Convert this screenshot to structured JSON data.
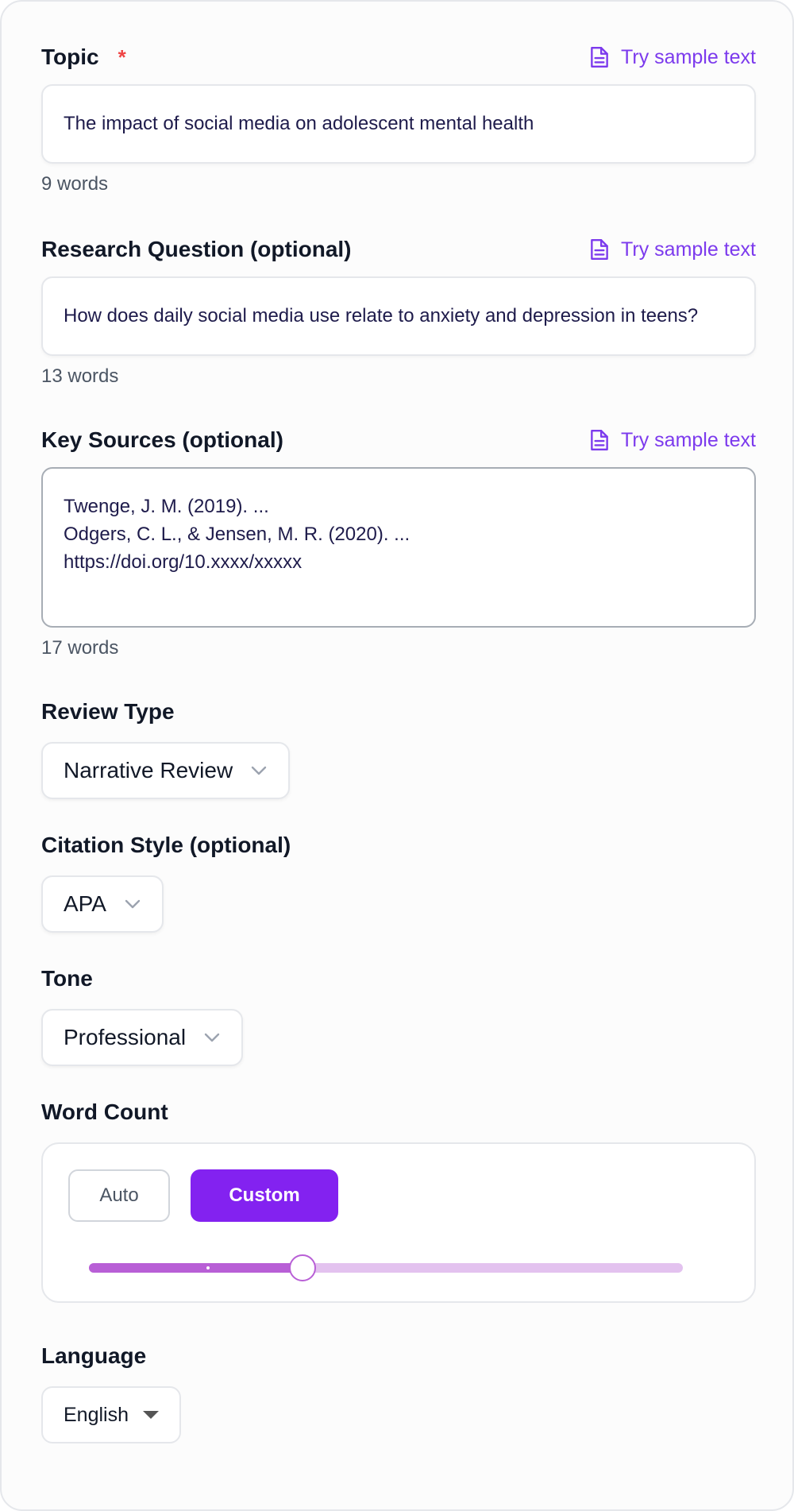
{
  "topic": {
    "label": "Topic",
    "required_mark": "*",
    "sample_link": "Try sample text",
    "value": "The impact of social media on adolescent mental health",
    "word_count": "9 words"
  },
  "research_question": {
    "label": "Research Question (optional)",
    "sample_link": "Try sample text",
    "value": "How does daily social media use relate to anxiety and depression in teens?",
    "word_count": "13 words"
  },
  "key_sources": {
    "label": "Key Sources (optional)",
    "sample_link": "Try sample text",
    "lines": [
      "Twenge, J. M. (2019). ...",
      "Odgers, C. L., & Jensen, M. R. (2020). ...",
      "https://doi.org/10.xxxx/xxxxx"
    ],
    "word_count": "17 words"
  },
  "review_type": {
    "label": "Review Type",
    "selected": "Narrative Review"
  },
  "citation_style": {
    "label": "Citation Style (optional)",
    "selected": "APA"
  },
  "tone": {
    "label": "Tone",
    "selected": "Professional"
  },
  "word_count_setting": {
    "label": "Word Count",
    "auto_label": "Auto",
    "custom_label": "Custom",
    "active_mode": "Custom",
    "slider_fraction": 0.36
  },
  "language": {
    "label": "Language",
    "selected": "English"
  },
  "colors": {
    "accent": "#8322f0",
    "link": "#7c3aed",
    "required": "#ef4444",
    "slider_fill": "#b85fd6",
    "slider_track": "#e3c2ef"
  },
  "icons": {
    "sample_link": "document-icon",
    "select": "chevron-down-icon",
    "language_select": "caret-down-icon"
  }
}
